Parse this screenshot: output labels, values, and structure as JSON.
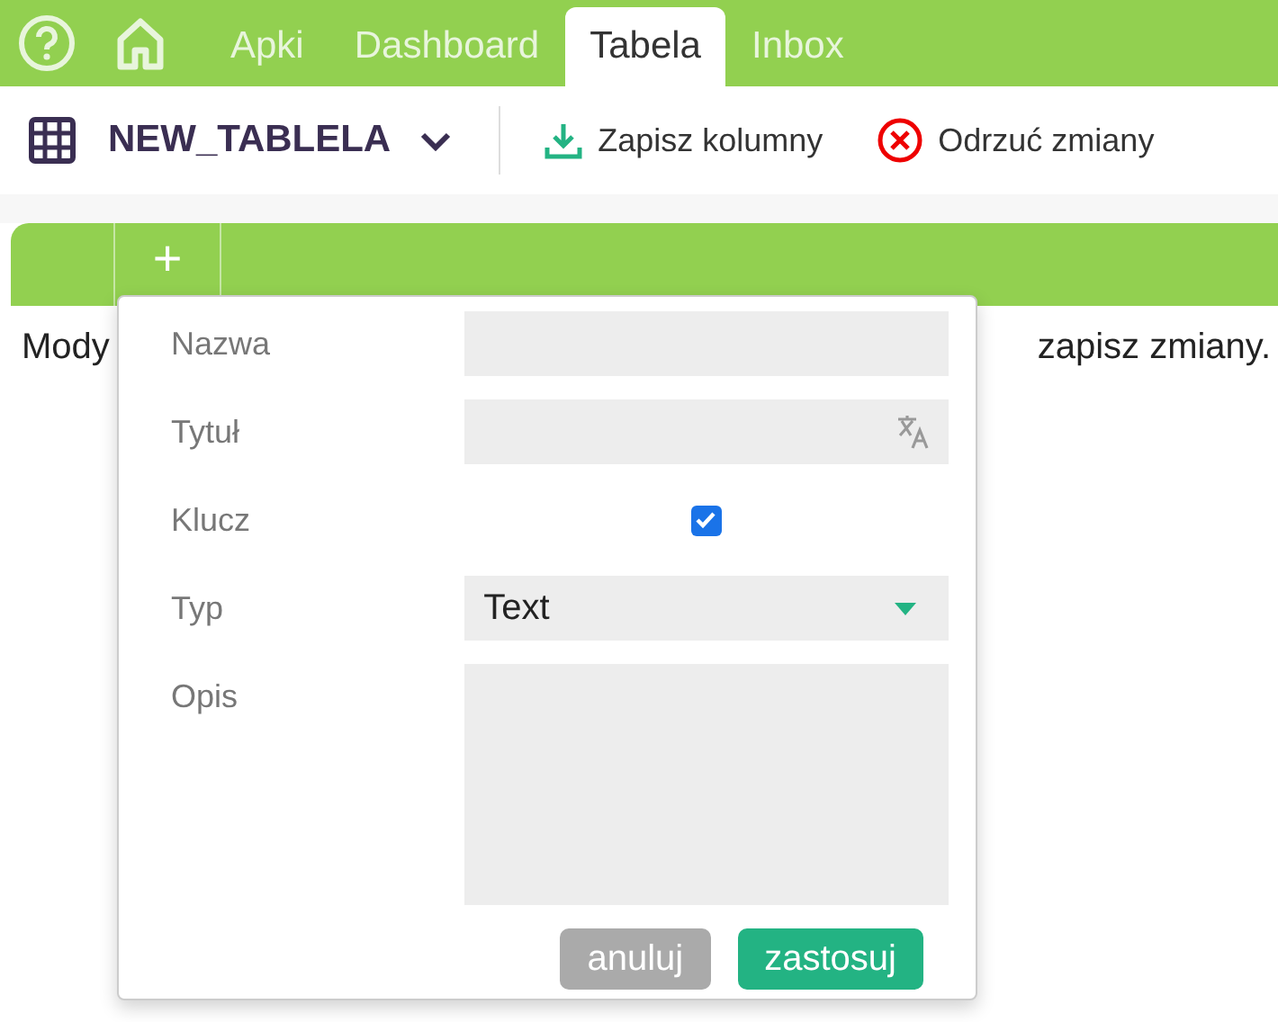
{
  "nav": {
    "tabs": [
      {
        "label": "Apki",
        "selected": false
      },
      {
        "label": "Dashboard",
        "selected": false
      },
      {
        "label": "Tabela",
        "selected": true
      },
      {
        "label": "Inbox",
        "selected": false
      }
    ]
  },
  "toolbar": {
    "table_name": "NEW_TABLELA",
    "actions": [
      {
        "kind": "save",
        "label": "Zapisz kolumny"
      },
      {
        "kind": "discard",
        "label": "Odrzuć zmiany"
      }
    ]
  },
  "grid": {
    "add_column": "+"
  },
  "message": {
    "left": "Mody",
    "right": "zapisz zmiany."
  },
  "popup": {
    "fields": [
      {
        "kind": "text",
        "label": "Nazwa"
      },
      {
        "kind": "translate",
        "label": "Tytuł"
      },
      {
        "kind": "checkbox",
        "label": "Klucz",
        "checked": true
      },
      {
        "kind": "select",
        "label": "Typ",
        "value": "Text"
      },
      {
        "kind": "textarea",
        "label": "Opis"
      }
    ],
    "buttons": [
      {
        "kind": "cancel",
        "label": "anuluj"
      },
      {
        "kind": "apply",
        "label": "zastosuj"
      }
    ]
  }
}
